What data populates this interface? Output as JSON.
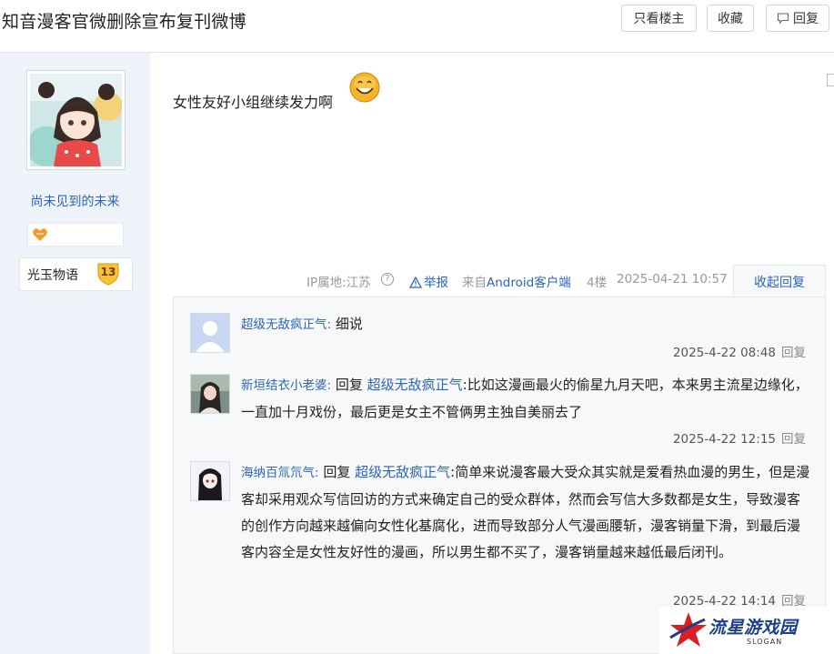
{
  "header": {
    "title": "知音漫客官微删除宣布复刊微博",
    "buttons": {
      "only_op": "只看楼主",
      "favorite": "收藏",
      "reply": "回复"
    }
  },
  "author": {
    "username": "尚未见到的未来",
    "level_name": "光玉物语",
    "level_number": "13"
  },
  "post": {
    "text": "女性友好小组继续发力啊",
    "meta": {
      "ip_location": "IP属地:江苏",
      "report": "举报",
      "source": "来自Android客户端",
      "floor": "4楼",
      "datetime": "2025-04-21 10:57",
      "collapse_replies": "收起回复"
    }
  },
  "replies": [
    {
      "user": "超级无敌疯正气:",
      "text": "细说",
      "time": "2025-4-22 08:48",
      "reply_label": "回复"
    },
    {
      "user": "新垣结衣小老婆:",
      "prefix": "回复",
      "to": "超级无敌疯正气",
      "text": ":比如这漫画最火的偷星九月天吧，本来男主流星边缘化，一直加十月戏份，最后更是女主不管俩男主独自美丽去了",
      "time": "2025-4-22 12:15",
      "reply_label": "回复"
    },
    {
      "user": "海纳百氚氘气:",
      "prefix": "回复",
      "to": "超级无敌疯正气",
      "text": ":简单来说漫客最大受众其实就是爱看热血漫的男生，但是漫客却采用观众写信回访的方式来确定自己的受众群体，然而会写信大多数都是女生，导致漫客的创作方向越来越偏向女性化基腐化，进而导致部分人气漫画腰斩，漫客销量下滑，到最后漫客内容全是女性友好性的漫画，所以男生都不买了，漫客销量越来越低最后闭刊。",
      "time": "2025-4-22 14:14",
      "reply_label": "回复"
    }
  ],
  "watermark": {
    "name": "流星游戏园",
    "slogan": "SLOGAN"
  },
  "colors": {
    "link_blue": "#2d64b3",
    "sidebar_bg": "#eef3fa",
    "reply_panel_bg": "#f7f8fa",
    "meta_gray": "#999999"
  },
  "icons": [
    "comment-icon",
    "help-circle-icon",
    "warning-triangle-icon",
    "level-shield-icon",
    "smile-emoji-icon",
    "star-logo-icon"
  ]
}
